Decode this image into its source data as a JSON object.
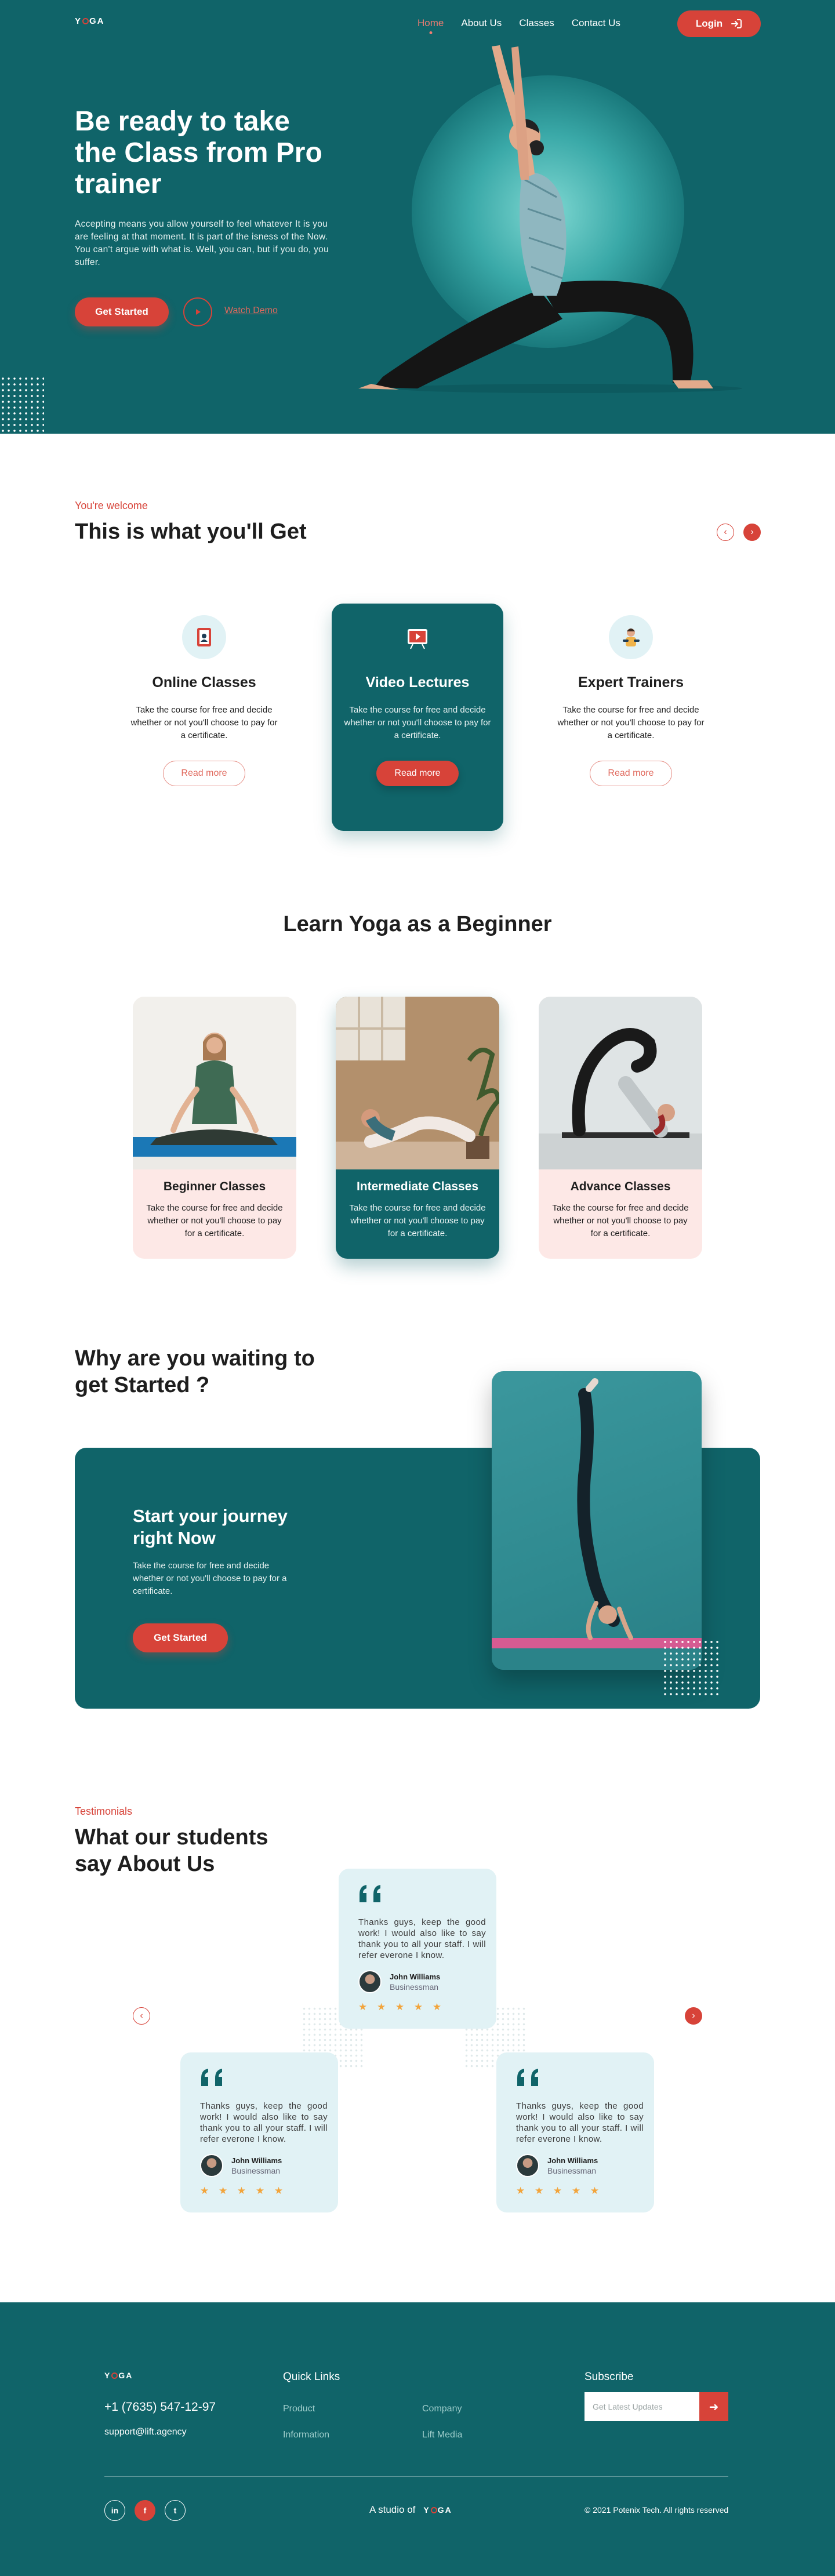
{
  "brand": {
    "logo_text": "YOGA",
    "accent": "#d74339",
    "primary": "#106469"
  },
  "nav": {
    "items": [
      {
        "label": "Home",
        "active": true
      },
      {
        "label": "About Us"
      },
      {
        "label": "Classes"
      },
      {
        "label": "Contact Us"
      }
    ],
    "login_label": "Login",
    "login_icon": "login-arrow-icon"
  },
  "hero": {
    "title": "Be ready to take the Class from Pro trainer",
    "text": "Accepting means you allow yourself to feel whatever It is you are feeling at that moment. It is part of the isness of the Now. You can't argue with what is. Well, you can, but if you do, you suffer.",
    "cta_label": "Get Started",
    "watch_label": "Watch Demo"
  },
  "get": {
    "eyebrow": "You're welcome",
    "title": "This is what you'll Get",
    "cards": [
      {
        "title": "Online Classes",
        "text": "Take the course for free and decide whether or not you'll choose to pay for a certificate.",
        "button": "Read more",
        "icon": "door-icon"
      },
      {
        "title": "Video Lectures",
        "text": "Take the course for free and decide whether or not you'll choose to pay for a certificate.",
        "button": "Read more",
        "icon": "video-board-icon"
      },
      {
        "title": "Expert Trainers",
        "text": "Take the course for free and decide whether or not you'll choose to pay for a certificate.",
        "button": "Read more",
        "icon": "trainer-icon"
      }
    ]
  },
  "learn": {
    "title": "Learn Yoga as a Beginner",
    "cards": [
      {
        "title": "Beginner Classes",
        "text": "Take the course for free and decide whether or not you'll choose to pay for a certificate."
      },
      {
        "title": "Intermediate Classes",
        "text": "Take the course for free and decide whether or not you'll choose to pay for a certificate."
      },
      {
        "title": "Advance Classes",
        "text": "Take the course for free and decide whether or not you'll choose to pay for a certificate."
      }
    ]
  },
  "cta": {
    "heading": "Why are you waiting to get Started ?",
    "title": "Start your journey right Now",
    "text": "Take the course for free and decide whether or not you'll choose to pay for a certificate.",
    "button": "Get Started"
  },
  "testimonials": {
    "eyebrow": "Testimonials",
    "title": "What our students say About Us",
    "items": [
      {
        "text": "Thanks guys, keep the good work! I would also like to say thank you to all your staff. I will refer everone I know.",
        "name": "John Williams",
        "role": "Businessman",
        "stars": "★ ★ ★ ★ ★"
      },
      {
        "text": "Thanks guys, keep the good work! I would also like to say thank you to all your staff. I will refer everone I know.",
        "name": "John Williams",
        "role": "Businessman",
        "stars": "★ ★ ★ ★ ★"
      },
      {
        "text": "Thanks guys, keep the good work! I would also like to say thank you to all your staff. I will refer everone I know.",
        "name": "John Williams",
        "role": "Businessman",
        "stars": "★ ★ ★ ★ ★"
      }
    ]
  },
  "footer": {
    "logo_text": "YOGA",
    "phone": "+1 (7635) 547-12-97",
    "email": "support@lift.agency",
    "quick_links_title": "Quick Links",
    "links": [
      "Product",
      "Company",
      "Information",
      "Lift Media"
    ],
    "subscribe_title": "Subscribe",
    "subscribe_placeholder": "Get Latest Updates",
    "social": [
      {
        "label": "in",
        "icon": "linkedin-icon"
      },
      {
        "label": "f",
        "icon": "facebook-icon"
      },
      {
        "label": "t",
        "icon": "twitter-icon"
      }
    ],
    "studio_label": "A studio of",
    "copyright": "© 2021 Potenix Tech. All rights reserved"
  }
}
